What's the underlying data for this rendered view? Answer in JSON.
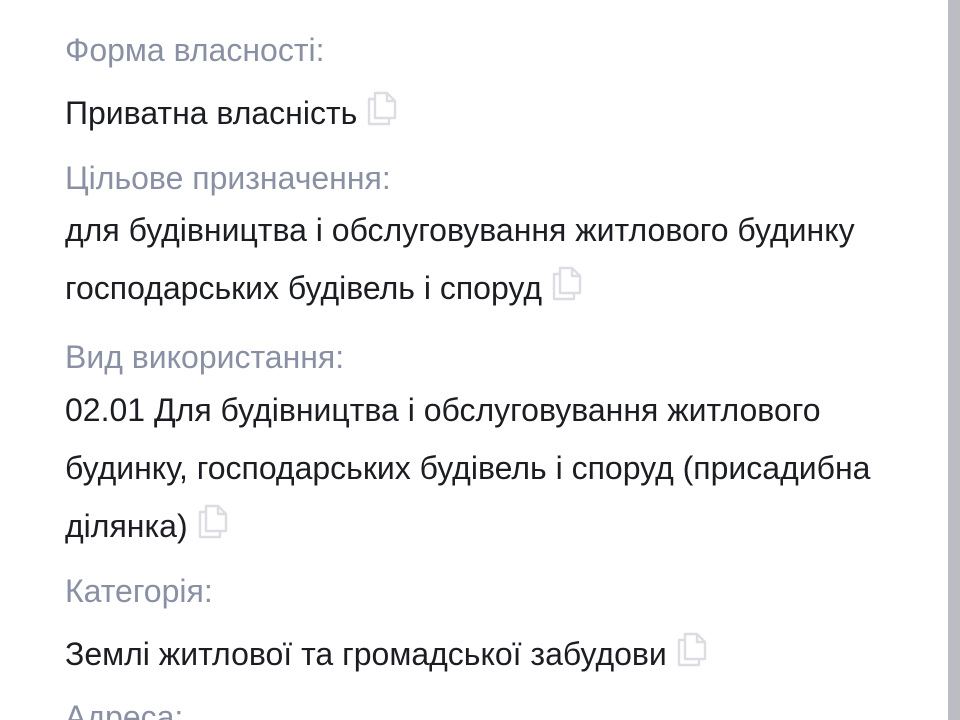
{
  "fields": [
    {
      "label": "Форма власності:",
      "value": "Приватна власність",
      "copy_icon": "copy-icon"
    },
    {
      "label": "Цільове призначення:",
      "value": "для будівництва і обслуговування житлового будинку господарських будівель і споруд",
      "copy_icon": "copy-icon"
    },
    {
      "label": "Вид використання:",
      "value": "02.01 Для будівництва і обслуговування житлового будинку, господарських будівель і споруд (присадибна ділянка)",
      "copy_icon": "copy-icon"
    },
    {
      "label": "Категорія:",
      "value": "Землі житлової та громадської забудови",
      "copy_icon": "copy-icon"
    },
    {
      "label": "Адреса:"
    }
  ],
  "colors": {
    "label": "#8990a4",
    "value": "#1b1d22",
    "copy_icon": "#dcdde2",
    "scrollbar": "#bcbdc2"
  }
}
